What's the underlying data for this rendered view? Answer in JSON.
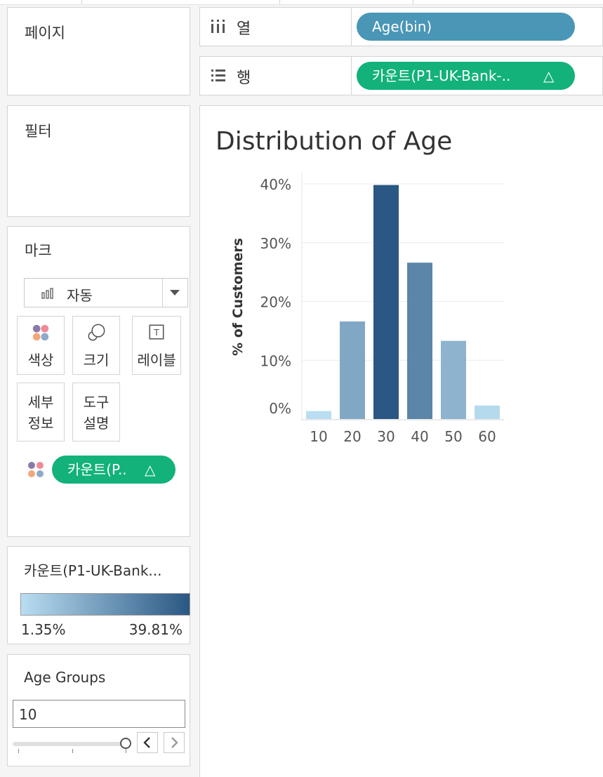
{
  "shelves": {
    "columns": {
      "label": "열",
      "pill": "Age(bin)"
    },
    "rows": {
      "label": "행",
      "pill": "카운트(P1-UK-Bank-..",
      "pill_icon": "delta-icon"
    }
  },
  "cards": {
    "pages": {
      "title": "페이지"
    },
    "filters": {
      "title": "필터"
    },
    "marks": {
      "title": "마크",
      "mark_type": "자동",
      "buttons": {
        "color": "색상",
        "size": "크기",
        "label": "레이블",
        "detail_1": "세부",
        "detail_2": "정보",
        "tooltip_1": "도구",
        "tooltip_2": "설명"
      },
      "color_pill": "카운트(P..",
      "color_pill_icon": "delta-icon"
    },
    "legend": {
      "title": "카운트(P1-UK-Bank...",
      "min": "1.35%",
      "max": "39.81%",
      "color_start": "#b9ddf1",
      "color_end": "#2a5783"
    },
    "age_groups": {
      "title": "Age Groups",
      "value": "10",
      "slider_level": 1.0
    }
  },
  "chart_data": {
    "type": "bar",
    "title": "Distribution of Age",
    "ylabel": "% of Customers",
    "xlabel": "",
    "categories": [
      "10",
      "20",
      "30",
      "40",
      "50",
      "60"
    ],
    "values": [
      1.35,
      16.6,
      39.81,
      26.6,
      13.3,
      2.3
    ],
    "yticks": [
      "0%",
      "10%",
      "20%",
      "30%",
      "40%"
    ],
    "ylim": [
      0,
      40
    ],
    "colormap": {
      "min_color": "#b9ddf1",
      "max_color": "#2a5783"
    },
    "grid": true
  }
}
